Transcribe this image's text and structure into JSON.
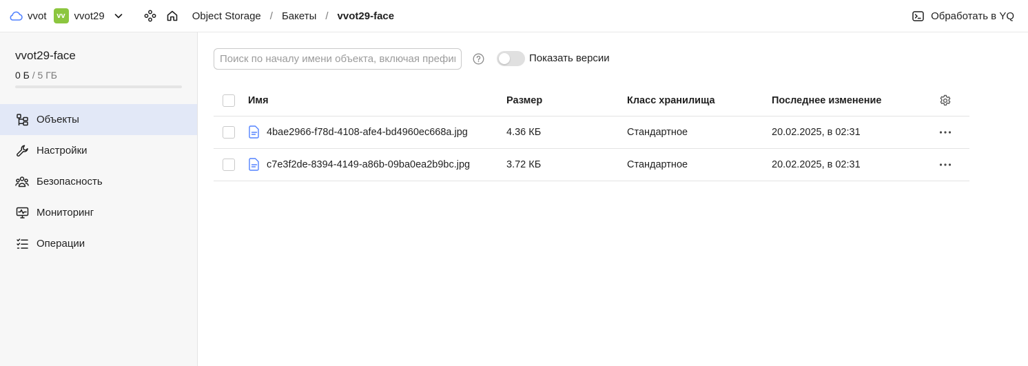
{
  "topbar": {
    "cloud_label": "vvot",
    "folder_badge": "vv",
    "folder_label": "vvot29",
    "breadcrumb": [
      "Object Storage",
      "Бакеты",
      "vvot29-face"
    ],
    "action_label": "Обработать в YQ"
  },
  "sidebar": {
    "bucket_name": "vvot29-face",
    "usage_used": "0 Б",
    "usage_total": "/ 5 ГБ",
    "usage_fraction": 0,
    "nav": [
      {
        "label": "Объекты",
        "icon": "objects-icon",
        "active": true
      },
      {
        "label": "Настройки",
        "icon": "wrench-icon",
        "active": false
      },
      {
        "label": "Безопасность",
        "icon": "users-icon",
        "active": false
      },
      {
        "label": "Мониторинг",
        "icon": "monitor-icon",
        "active": false
      },
      {
        "label": "Операции",
        "icon": "list-icon",
        "active": false
      }
    ]
  },
  "main": {
    "search_placeholder": "Поиск по началу имени объекта, включая префикс",
    "show_versions_label": "Показать версии",
    "show_versions_on": false,
    "columns": [
      "Имя",
      "Размер",
      "Класс хранилища",
      "Последнее изменение"
    ],
    "rows": [
      {
        "name": "4bae2966-f78d-4108-afe4-bd4960ec668a.jpg",
        "size": "4.36 КБ",
        "class": "Стандартное",
        "modified": "20.02.2025, в 02:31"
      },
      {
        "name": "c7e3f2de-8394-4149-a86b-09ba0ea2b9bc.jpg",
        "size": "3.72 КБ",
        "class": "Стандартное",
        "modified": "20.02.2025, в 02:31"
      }
    ]
  },
  "colors": {
    "accent": "#5282ff",
    "folder_badge": "#8cc63f",
    "active_nav": "#e2e8f7",
    "usage_bar": "#8b5cf6"
  }
}
